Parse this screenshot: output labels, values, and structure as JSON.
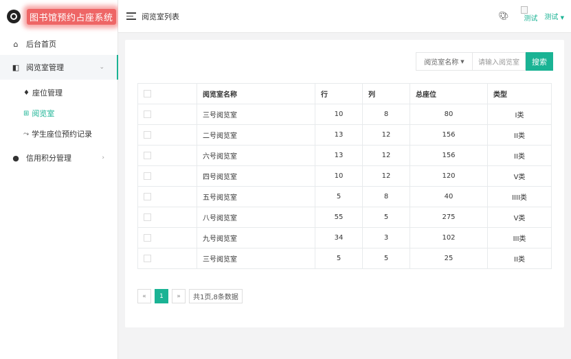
{
  "app": {
    "title": "图书馆预约占座系统"
  },
  "sidebar": {
    "items": [
      {
        "label": "后台首页"
      },
      {
        "label": "阅览室管理",
        "sub": [
          {
            "label": "座位管理"
          },
          {
            "label": "阅览室"
          },
          {
            "label": "学生座位预约记录"
          }
        ]
      },
      {
        "label": "信用积分管理"
      }
    ]
  },
  "header": {
    "page_title": "阅览室列表",
    "avatar_alt": "测试",
    "user_name": "测试"
  },
  "search": {
    "select_value": "阅览室名称",
    "placeholder": "请输入阅览室",
    "button": "搜索"
  },
  "table": {
    "headers": [
      "",
      "阅览室名称",
      "行",
      "列",
      "总座位",
      "类型"
    ],
    "rows": [
      [
        "三号阅览室",
        "10",
        "8",
        "80",
        "I类"
      ],
      [
        "二号阅览室",
        "13",
        "12",
        "156",
        "II类"
      ],
      [
        "六号阅览室",
        "13",
        "12",
        "156",
        "II类"
      ],
      [
        "四号阅览室",
        "10",
        "12",
        "120",
        "V类"
      ],
      [
        "五号阅览室",
        "5",
        "8",
        "40",
        "IIII类"
      ],
      [
        "八号阅览室",
        "55",
        "5",
        "275",
        "V类"
      ],
      [
        "九号阅览室",
        "34",
        "3",
        "102",
        "III类"
      ],
      [
        "三号阅览室",
        "5",
        "5",
        "25",
        "II类"
      ]
    ]
  },
  "pagination": {
    "prev": "«",
    "current": "1",
    "next": "»",
    "info": "共1页,8条数据"
  },
  "colors": {
    "accent": "#1ab394",
    "brand_bg": "#e66666"
  }
}
